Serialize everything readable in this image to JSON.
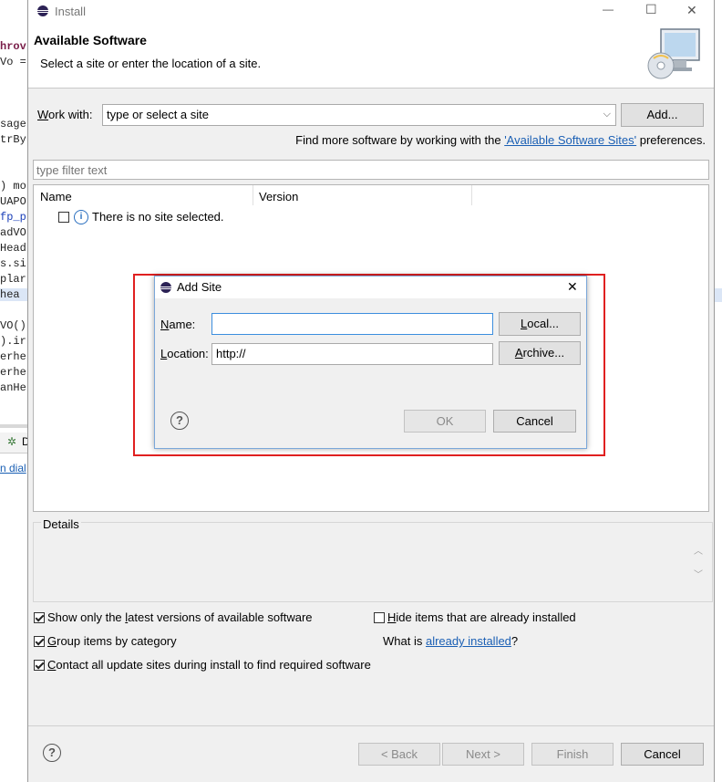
{
  "editor_fragments": [
    "hrov",
    "Vo =",
    "sage",
    "trBy",
    ") mo",
    "UAPO",
    "fp_p",
    "adVO",
    "Head",
    "s.si",
    "plar",
    "hea",
    "VO()",
    ").ir",
    "erhe",
    "erhe",
    "anHe",
    "n dial"
  ],
  "window": {
    "title": "Install",
    "controls": {
      "minimize": "—",
      "maximize": "☐",
      "close": "✕"
    }
  },
  "header": {
    "title": "Available Software",
    "subtitle": "Select a site or enter the location of a site."
  },
  "work_with": {
    "label_prefix": "W",
    "label_rest": "ork with:",
    "value": "type or select a site",
    "add_button": "Add..."
  },
  "find_more": {
    "prefix": "Find more software by working with the ",
    "link": "'Available Software Sites'",
    "suffix": " preferences."
  },
  "filter": {
    "placeholder": "type filter text"
  },
  "table": {
    "columns": [
      "Name",
      "Version"
    ],
    "rows": [
      {
        "text": "There is no site selected."
      }
    ]
  },
  "details": {
    "label": "Details"
  },
  "options": {
    "show_latest": {
      "pre": "Show only the ",
      "u": "l",
      "post": "atest versions of available software",
      "checked": true
    },
    "group_items": {
      "u": "G",
      "post": "roup items by category",
      "checked": true
    },
    "contact_sites": {
      "u": "C",
      "post": "ontact all update sites during install to find required software",
      "checked": true
    },
    "hide_installed": {
      "u": "H",
      "post": "ide items that are already installed",
      "checked": false
    },
    "what_is": {
      "prefix": "What is ",
      "link": "already installed",
      "suffix": "?"
    }
  },
  "footer": {
    "back": "< Back",
    "next": "Next >",
    "finish": "Finish",
    "cancel": "Cancel"
  },
  "add_site": {
    "title": "Add Site",
    "close": "✕",
    "name_label": "Name:",
    "name_value": "",
    "location_label": "Location:",
    "location_value": "http://",
    "local_button": "Local...",
    "archive_button": "Archive...",
    "ok": "OK",
    "cancel": "Cancel"
  },
  "bottom_tab": "D",
  "colors": {
    "highlight_box": "#e02020",
    "link": "#1a5fb4",
    "dialog_border": "#7aa7d9"
  }
}
